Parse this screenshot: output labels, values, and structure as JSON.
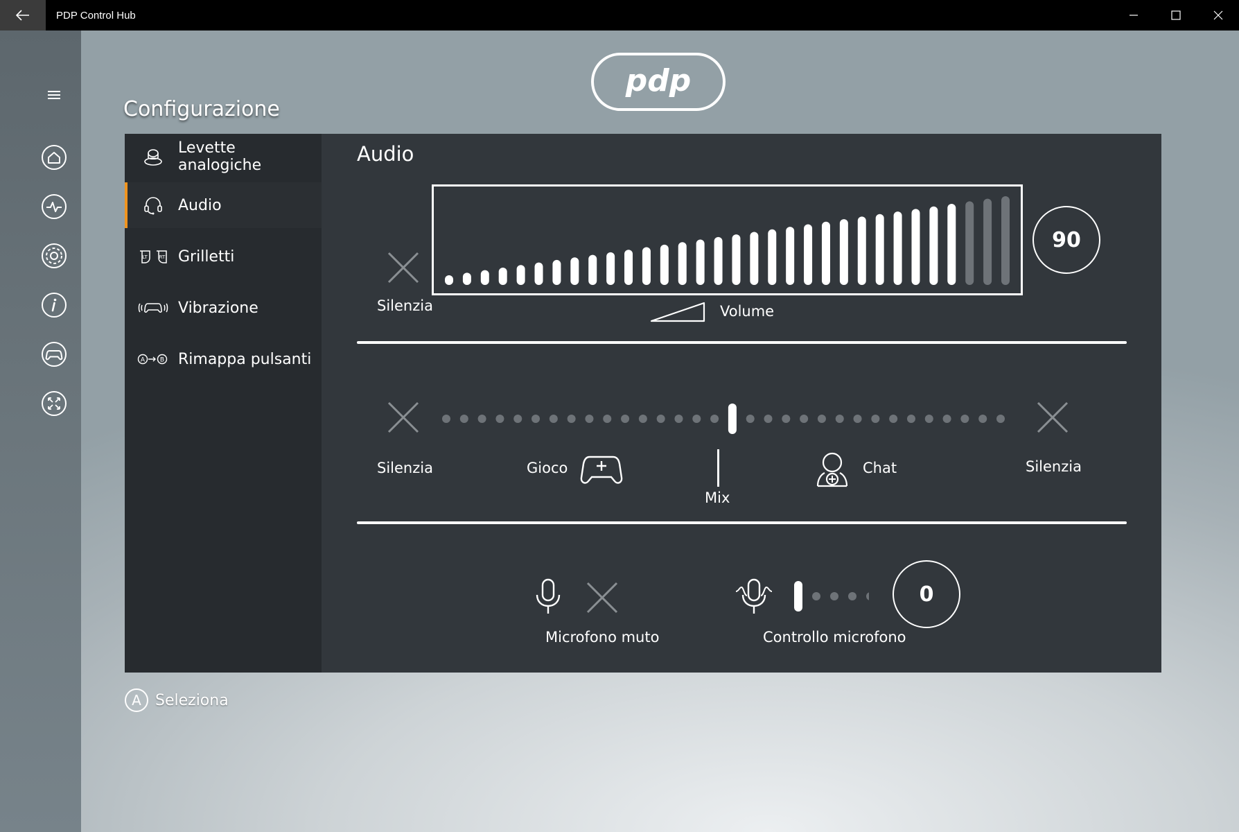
{
  "window": {
    "title": "PDP Control Hub"
  },
  "header": {
    "page_title": "Configurazione"
  },
  "sidebar": {
    "items": [
      {
        "label": "Levette analogiche",
        "icon": "joystick-icon",
        "active": false
      },
      {
        "label": "Audio",
        "icon": "headset-icon",
        "active": true
      },
      {
        "label": "Grilletti",
        "icon": "triggers-icon",
        "active": false
      },
      {
        "label": "Vibrazione",
        "icon": "vibration-icon",
        "active": false
      },
      {
        "label": "Rimappa pulsanti",
        "icon": "remap-icon",
        "active": false
      }
    ]
  },
  "rail": {
    "items": [
      "menu-icon",
      "home-icon",
      "activity-icon",
      "settings-icon",
      "info-icon",
      "controller-icon",
      "fullscreen-icon"
    ]
  },
  "audio": {
    "title": "Audio",
    "volume": {
      "mute_label": "Silenzia",
      "label": "Volume",
      "value": "90",
      "level_fraction": 0.9,
      "bar_count": 32
    },
    "mix": {
      "left_mute_label": "Silenzia",
      "right_mute_label": "Silenzia",
      "game_label": "Gioco",
      "chat_label": "Chat",
      "mix_label": "Mix",
      "position_fraction": 0.5,
      "dot_count": 32
    },
    "mic": {
      "mute_label": "Microfono muto",
      "control_label": "Controllo microfono",
      "value": "0",
      "dot_count": 5
    }
  },
  "footer": {
    "button_glyph": "A",
    "select_label": "Seleziona"
  },
  "colors": {
    "accent": "#f0941f",
    "panel": "#32373c",
    "sidebar": "#272b2f"
  }
}
